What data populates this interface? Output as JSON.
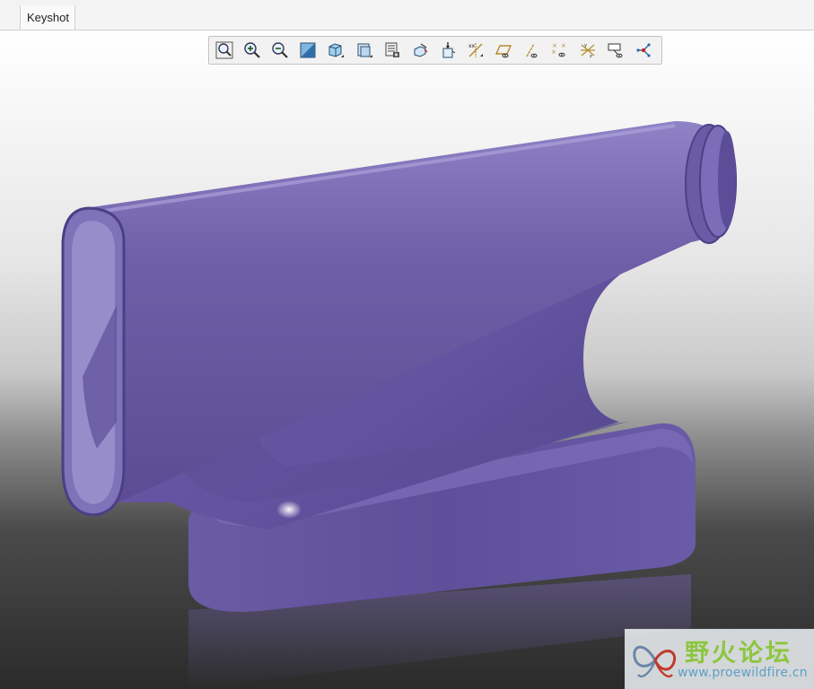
{
  "tabs": [
    {
      "label": "Keyshot"
    }
  ],
  "toolbar": {
    "buttons": [
      "zoom-fit-icon",
      "zoom-in-icon",
      "zoom-out-icon",
      "shading-icon",
      "view-cube-icon",
      "saved-views-icon",
      "display-settings-icon",
      "repaint-icon",
      "orient-icon",
      "datum-axis-icon",
      "plane-display-icon",
      "axis-display-icon",
      "point-display-icon",
      "csys-display-icon",
      "annotation-display-icon",
      "spin-center-icon"
    ]
  },
  "model": {
    "color": "#6e5fa6"
  },
  "watermark": {
    "title": "野火论坛",
    "url": "www.proewildfire.cn"
  }
}
